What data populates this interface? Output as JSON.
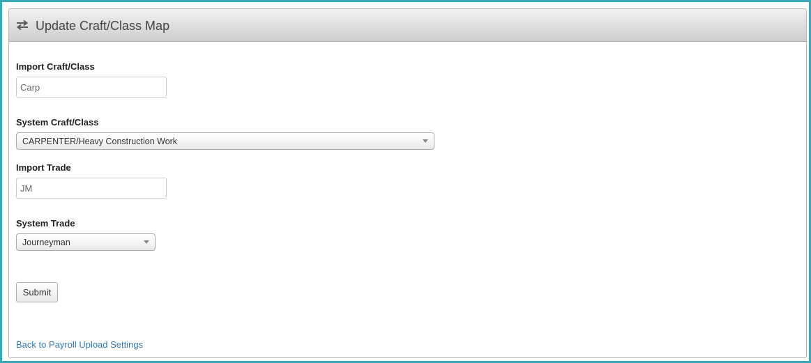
{
  "panel": {
    "title": "Update Craft/Class Map",
    "icon": "exchange-arrows-icon"
  },
  "form": {
    "import_craft_class": {
      "label": "Import Craft/Class",
      "value": "Carp"
    },
    "system_craft_class": {
      "label": "System Craft/Class",
      "selected": "CARPENTER/Heavy Construction Work"
    },
    "import_trade": {
      "label": "Import Trade",
      "value": "JM"
    },
    "system_trade": {
      "label": "System Trade",
      "selected": "Journeyman"
    },
    "submit_label": "Submit"
  },
  "links": {
    "back": "Back to Payroll Upload Settings"
  },
  "colors": {
    "frame_border": "#39a9b8",
    "link": "#337ab7",
    "header_gradient_top": "#f1f1f1",
    "header_gradient_bottom": "#cfcfcf"
  }
}
